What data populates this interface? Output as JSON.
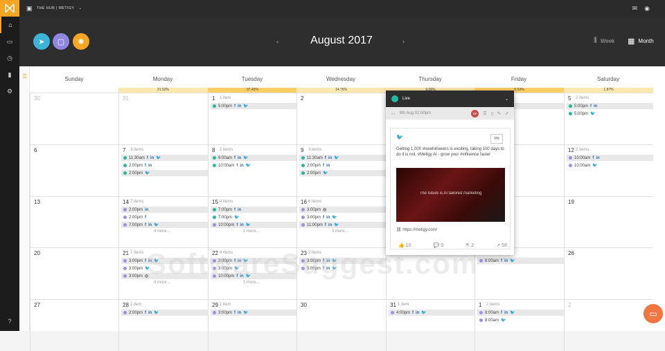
{
  "app": {
    "brand": "THE HUB | METIGY"
  },
  "header": {
    "month": "August 2017",
    "week_label": "Week",
    "month_label": "Month",
    "prev": "‹",
    "next": "›"
  },
  "days": [
    "Sunday",
    "Monday",
    "Tuesday",
    "Wednesday",
    "Thursday",
    "Friday",
    "Saturday"
  ],
  "percentages": [
    "21.52%",
    "37.43%",
    "14.76%",
    "9.09%",
    "5.53%",
    "1.87%"
  ],
  "weeks": [
    [
      {
        "d": "30"
      },
      {
        "d": "31"
      },
      {
        "d": "1",
        "c": "1 item",
        "ev": [
          [
            "teal",
            "5:00pm",
            "fi t"
          ]
        ]
      },
      {
        "d": "2"
      },
      {
        "d": ""
      },
      {
        "d": "",
        "ev": [
          [
            "",
            "",
            "t"
          ]
        ]
      },
      {
        "d": "5",
        "c": "2 items",
        "ev": [
          [
            "teal",
            "5:00pm",
            "fi"
          ],
          [
            "teal",
            "5:00pm",
            "t"
          ]
        ]
      }
    ],
    [
      {
        "d": "6"
      },
      {
        "d": "7",
        "c": "3 items",
        "ev": [
          [
            "teal",
            "11:30am",
            "fi t"
          ],
          [
            "teal",
            "2:00pm",
            "fi"
          ],
          [
            "teal",
            "2:00pm",
            "t"
          ]
        ]
      },
      {
        "d": "8",
        "c": "2 items",
        "ev": [
          [
            "teal",
            "9:00am",
            "fi t"
          ],
          [
            "teal",
            "10:00am",
            "fi t"
          ]
        ]
      },
      {
        "d": "9",
        "c": "3 items",
        "ev": [
          [
            "teal",
            "11:30am",
            "fi t"
          ],
          [
            "teal",
            "2:00pm",
            "fi"
          ],
          [
            "teal",
            "2:00pm",
            "t"
          ]
        ]
      },
      {
        "d": ""
      },
      {
        "d": ""
      },
      {
        "d": "12",
        "c": "2 items",
        "ev": [
          [
            "purple",
            "10:00am",
            "fi"
          ],
          [
            "purple",
            "10:00am",
            "t"
          ]
        ]
      }
    ],
    [
      {
        "d": "13"
      },
      {
        "d": "14",
        "c": "7 items",
        "ev": [
          [
            "purple",
            "2:00pm",
            "in"
          ],
          [
            "purple",
            "2:00pm",
            "f"
          ],
          [
            "purple",
            "7:00pm",
            "fi t"
          ]
        ],
        "more": "4 more..."
      },
      {
        "d": "15",
        "c": "4 items",
        "ev": [
          [
            "teal",
            "7:00pm",
            "fi"
          ],
          [
            "teal",
            "7:00pm",
            "t"
          ],
          [
            "purple",
            "10:00pm",
            "fi t"
          ]
        ],
        "more": "1 more..."
      },
      {
        "d": "16",
        "c": "6 items",
        "ev": [
          [
            "purple",
            "3:00pm",
            "ig"
          ],
          [
            "purple",
            "3:00pm",
            "fi t"
          ],
          [
            "purple",
            "11:00pm",
            "fi t"
          ]
        ],
        "more": "3 more..."
      },
      {
        "d": ""
      },
      {
        "d": ""
      },
      {
        "d": "19"
      }
    ],
    [
      {
        "d": "20"
      },
      {
        "d": "21",
        "c": "7 items",
        "ev": [
          [
            "purple",
            "3:00pm",
            "fi t"
          ],
          [
            "purple",
            "3:00pm",
            "t"
          ],
          [
            "purple",
            "3:00pm",
            "ig"
          ]
        ],
        "more": "4 more..."
      },
      {
        "d": "22",
        "c": "4 items",
        "ev": [
          [
            "purple",
            "3:00pm",
            "fi t"
          ],
          [
            "purple",
            "3:00pm",
            "t"
          ],
          [
            "purple",
            "10:00pm",
            "fi t"
          ]
        ],
        "more": "1 more..."
      },
      {
        "d": "23",
        "c": "2 items",
        "ev": [
          [
            "purple",
            "3:00pm",
            "fi t"
          ],
          [
            "purple",
            "5:00pm",
            "fi t"
          ]
        ]
      },
      {
        "d": ""
      },
      {
        "d": "",
        "ev": [
          [
            "purple",
            "8:00am",
            "fi t"
          ]
        ]
      },
      {
        "d": "26"
      }
    ],
    [
      {
        "d": "27"
      },
      {
        "d": "28",
        "c": "1 item",
        "ev": [
          [
            "purple",
            "2:00pm",
            "fi t"
          ]
        ]
      },
      {
        "d": "29",
        "c": "1 item",
        "ev": [
          [
            "purple",
            "3:00pm",
            "fi t"
          ]
        ]
      },
      {
        "d": "30"
      },
      {
        "d": "31",
        "c": "1 item",
        "ev": [
          [
            "purple",
            "4:00pm",
            "fi t"
          ]
        ]
      },
      {
        "d": "1",
        "c": "2 items",
        "ev": [
          [
            "purple",
            "8:00am",
            "fi t"
          ],
          [
            "purple",
            "8:00am",
            "t"
          ]
        ]
      },
      {
        "d": "2",
        "muted": true
      }
    ]
  ],
  "popup": {
    "status": "Live",
    "datetime": "9th Aug 02:00pm",
    "initials": "DF",
    "pr": "PR",
    "text": "Getting 1,000 #newfollowers is exciting, taking 100 days to do it is not. #Metigy AI - grow your #influence faster",
    "image_text": "The future is AI tailored marketing",
    "link": "https://metigy.com/",
    "likes": "10",
    "comments": "0",
    "shares": "2",
    "reach": "58"
  },
  "watermark": "SoftwareSuggest.com"
}
